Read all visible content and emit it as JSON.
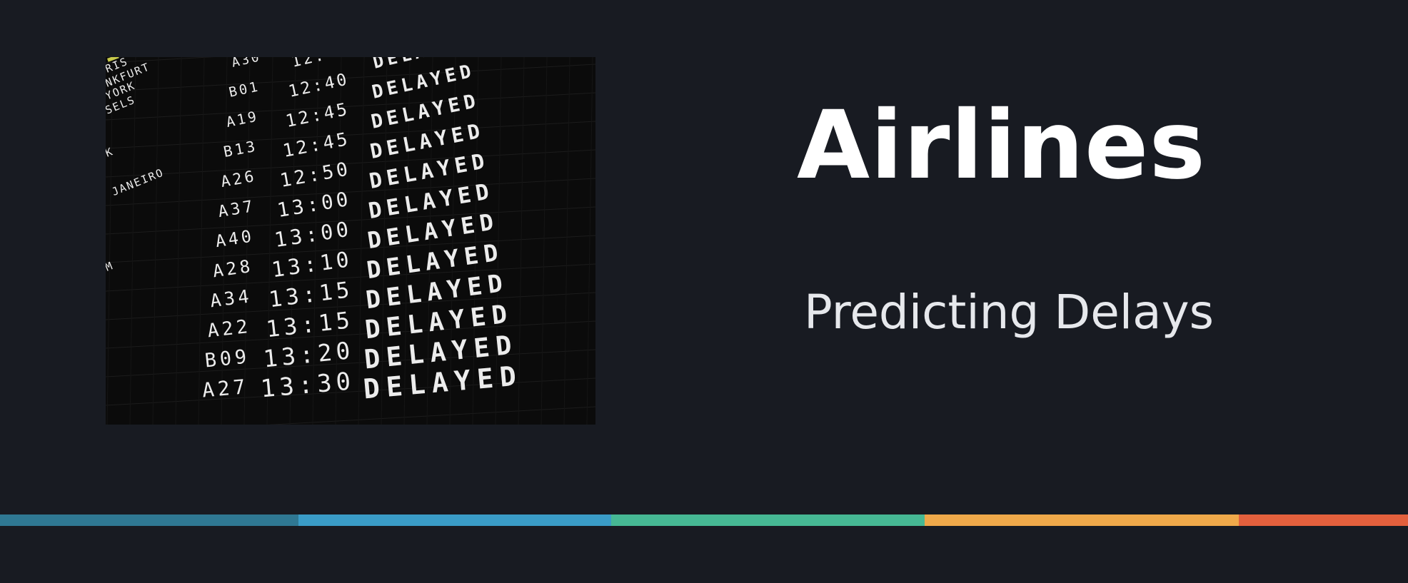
{
  "slide": {
    "title": "Airlines",
    "subtitle": "Predicting Delays"
  },
  "departure_board": {
    "destinations": [
      "RIS",
      "NKFURT",
      "YORK",
      "SELS",
      "K",
      "",
      "JANEIRO",
      "",
      "M"
    ],
    "rows": [
      {
        "gate": "A30",
        "time": "12:",
        "status": "DELA"
      },
      {
        "gate": "B01",
        "time": "12:40",
        "status": "DELAYED"
      },
      {
        "gate": "A19",
        "time": "12:45",
        "status": "DELAYED"
      },
      {
        "gate": "B13",
        "time": "12:45",
        "status": "DELAYED"
      },
      {
        "gate": "A26",
        "time": "12:50",
        "status": "DELAYED"
      },
      {
        "gate": "A37",
        "time": "13:00",
        "status": "DELAYED"
      },
      {
        "gate": "A40",
        "time": "13:00",
        "status": "DELAYED"
      },
      {
        "gate": "A28",
        "time": "13:10",
        "status": "DELAYED"
      },
      {
        "gate": "A34",
        "time": "13:15",
        "status": "DELAYED"
      },
      {
        "gate": "A22",
        "time": "13:15",
        "status": "DELAYED"
      },
      {
        "gate": "B09",
        "time": "13:20",
        "status": "DELAYED"
      },
      {
        "gate": "A27",
        "time": "13:30",
        "status": "DELAYED"
      }
    ]
  },
  "colors": {
    "background": "#181b22",
    "board": "#0b0b0b",
    "stripe": [
      "#2f7893",
      "#3a9cc7",
      "#46b894",
      "#efa94a",
      "#e3603d"
    ]
  }
}
